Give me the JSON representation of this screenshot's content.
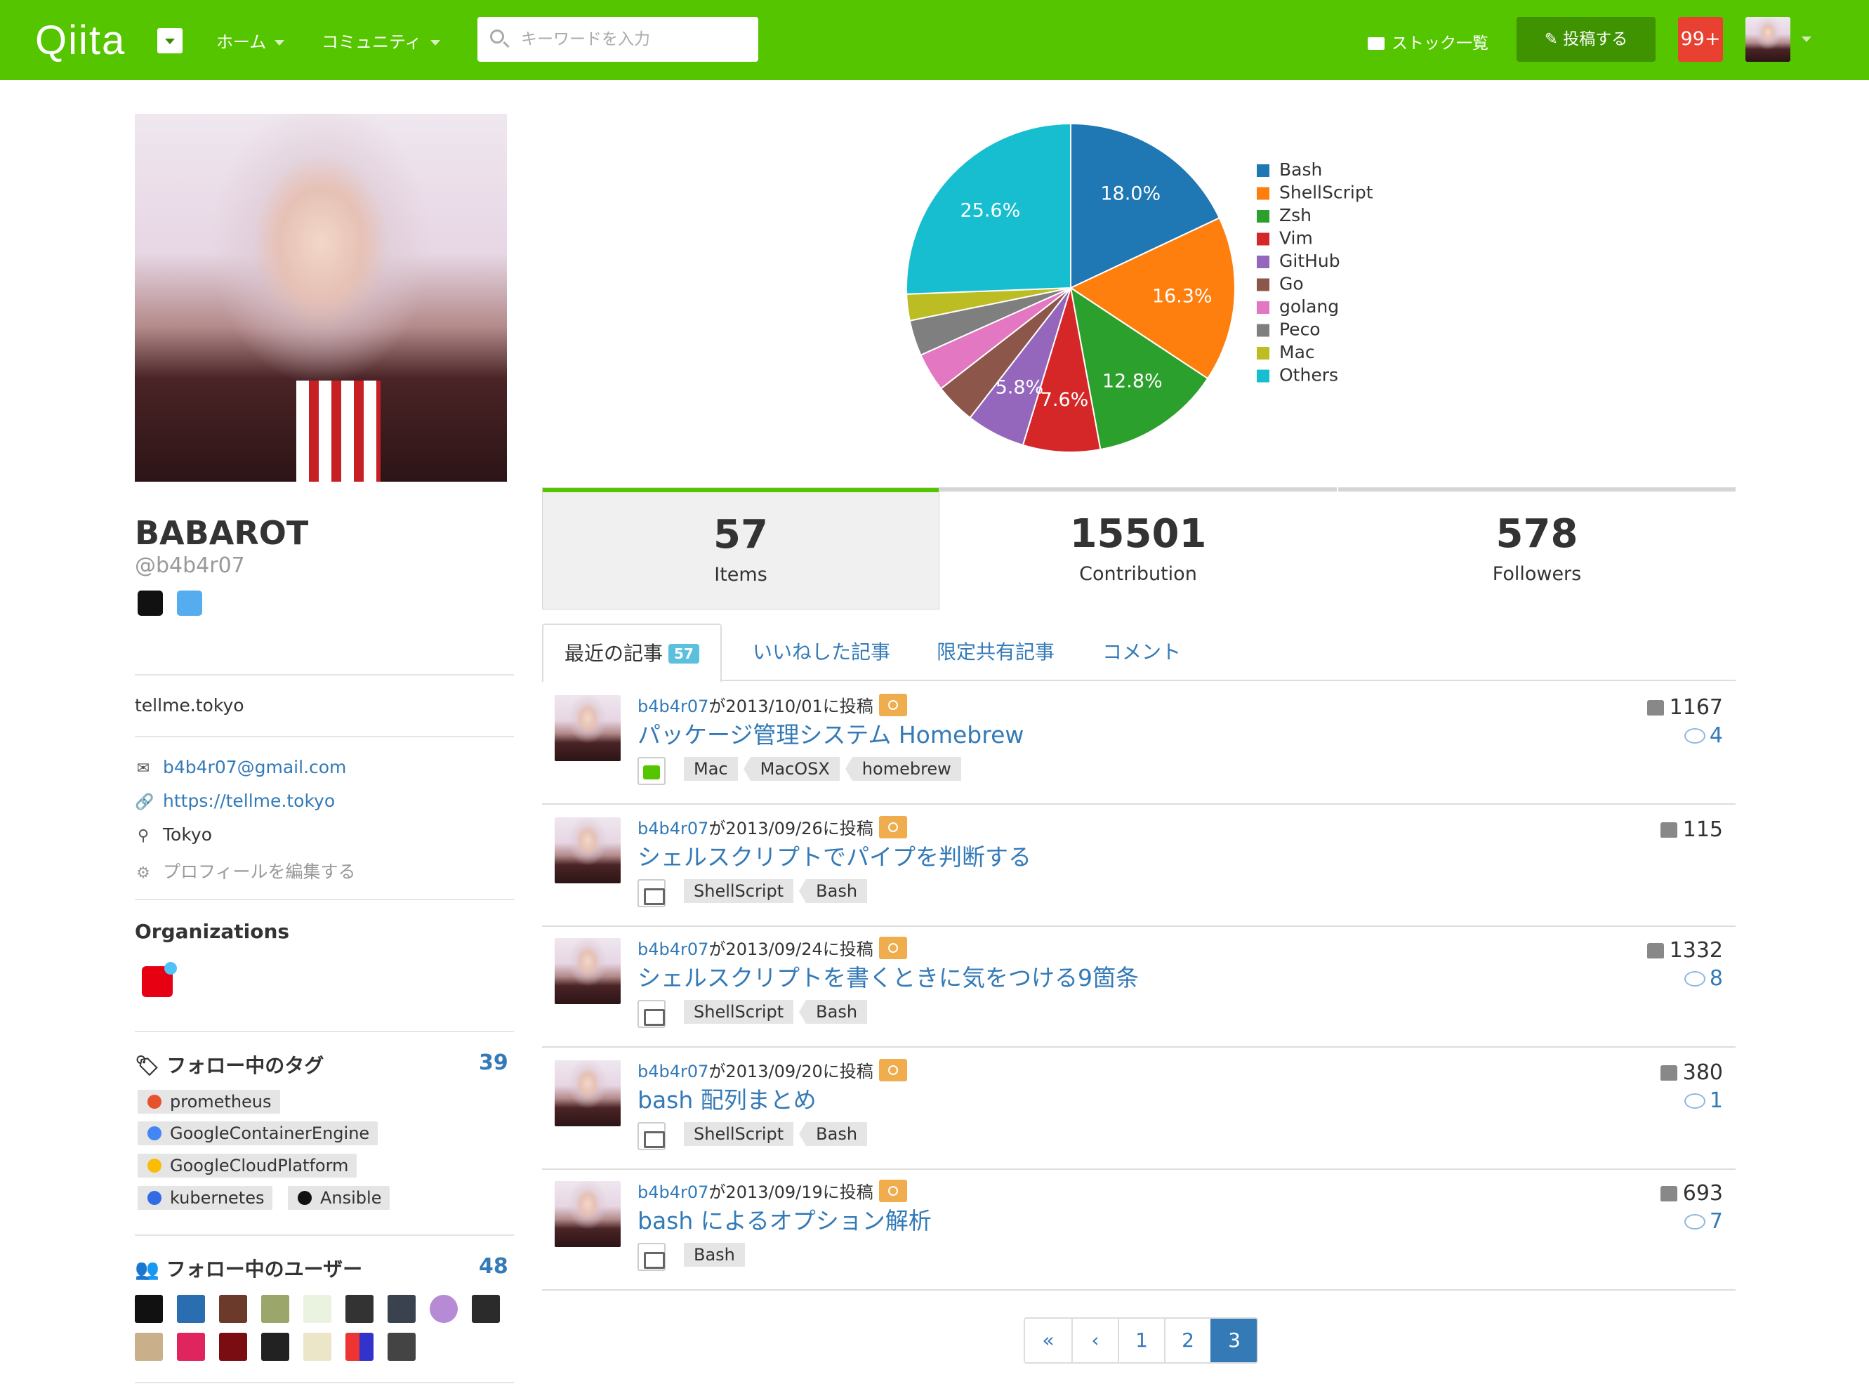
{
  "header": {
    "logo": "Qiita",
    "nav": [
      "ホーム",
      "コミュニティ"
    ],
    "search_placeholder": "キーワードを入力",
    "stock_label": "ストック一覧",
    "post_label": "投稿する",
    "notif_count": "99+"
  },
  "profile": {
    "display_name": "BABAROT",
    "user_id": "@b4b4r07",
    "description": "tellme.tokyo",
    "email": "b4b4r07@gmail.com",
    "website": "https://tellme.tokyo",
    "location": "Tokyo",
    "edit_label": "プロフィールを編集する",
    "organizations_heading": "Organizations",
    "following_tags_heading": "フォロー中のタグ",
    "following_tags_count": "39",
    "following_tags": [
      "prometheus",
      "GoogleContainerEngine",
      "GoogleCloudPlatform",
      "kubernetes",
      "Ansible"
    ],
    "following_users_heading": "フォロー中のユーザー",
    "following_users_count": "48"
  },
  "stats": [
    {
      "value": "57",
      "label": "Items"
    },
    {
      "value": "15501",
      "label": "Contribution"
    },
    {
      "value": "578",
      "label": "Followers"
    }
  ],
  "tabs": {
    "recent": "最近の記事",
    "recent_count": "57",
    "liked": "いいねした記事",
    "limited": "限定共有記事",
    "comments": "コメント"
  },
  "items": [
    {
      "author": "b4b4r07",
      "posted": "が2013/10/01に投稿",
      "title": "パッケージ管理システム Homebrew",
      "tags": [
        "Mac",
        "MacOSX",
        "homebrew"
      ],
      "icon": "check",
      "likes": "1167",
      "comments": "4"
    },
    {
      "author": "b4b4r07",
      "posted": "が2013/09/26に投稿",
      "title": "シェルスクリプトでパイプを判断する",
      "tags": [
        "ShellScript",
        "Bash"
      ],
      "icon": "folder",
      "likes": "115",
      "comments": ""
    },
    {
      "author": "b4b4r07",
      "posted": "が2013/09/24に投稿",
      "title": "シェルスクリプトを書くときに気をつける9箇条",
      "tags": [
        "ShellScript",
        "Bash"
      ],
      "icon": "folder",
      "likes": "1332",
      "comments": "8"
    },
    {
      "author": "b4b4r07",
      "posted": "が2013/09/20に投稿",
      "title": "bash 配列まとめ",
      "tags": [
        "ShellScript",
        "Bash"
      ],
      "icon": "folder",
      "likes": "380",
      "comments": "1"
    },
    {
      "author": "b4b4r07",
      "posted": "が2013/09/19に投稿",
      "title": "bash によるオプション解析",
      "tags": [
        "Bash"
      ],
      "icon": "folder",
      "likes": "693",
      "comments": "7"
    }
  ],
  "pagination": [
    "«",
    "‹",
    "1",
    "2",
    "3"
  ],
  "pagination_current": "3",
  "chart_data": {
    "type": "pie",
    "labels": [
      "Bash",
      "ShellScript",
      "Zsh",
      "Vim",
      "GitHub",
      "Go",
      "golang",
      "Peco",
      "Mac",
      "Others"
    ],
    "values": [
      18.0,
      16.3,
      12.8,
      7.6,
      5.8,
      4.0,
      3.8,
      3.5,
      2.6,
      25.6
    ],
    "slice_labels": [
      "18.0%",
      "16.3%",
      "12.8%",
      "7.6%",
      "5.8%",
      "",
      "",
      "",
      "",
      "25.6%"
    ],
    "colors": [
      "#1f77b4",
      "#ff7f0e",
      "#2ca02c",
      "#d62728",
      "#9467bd",
      "#8c564b",
      "#e377c2",
      "#7f7f7f",
      "#bcbd22",
      "#17becf"
    ],
    "legend_position": "right"
  }
}
